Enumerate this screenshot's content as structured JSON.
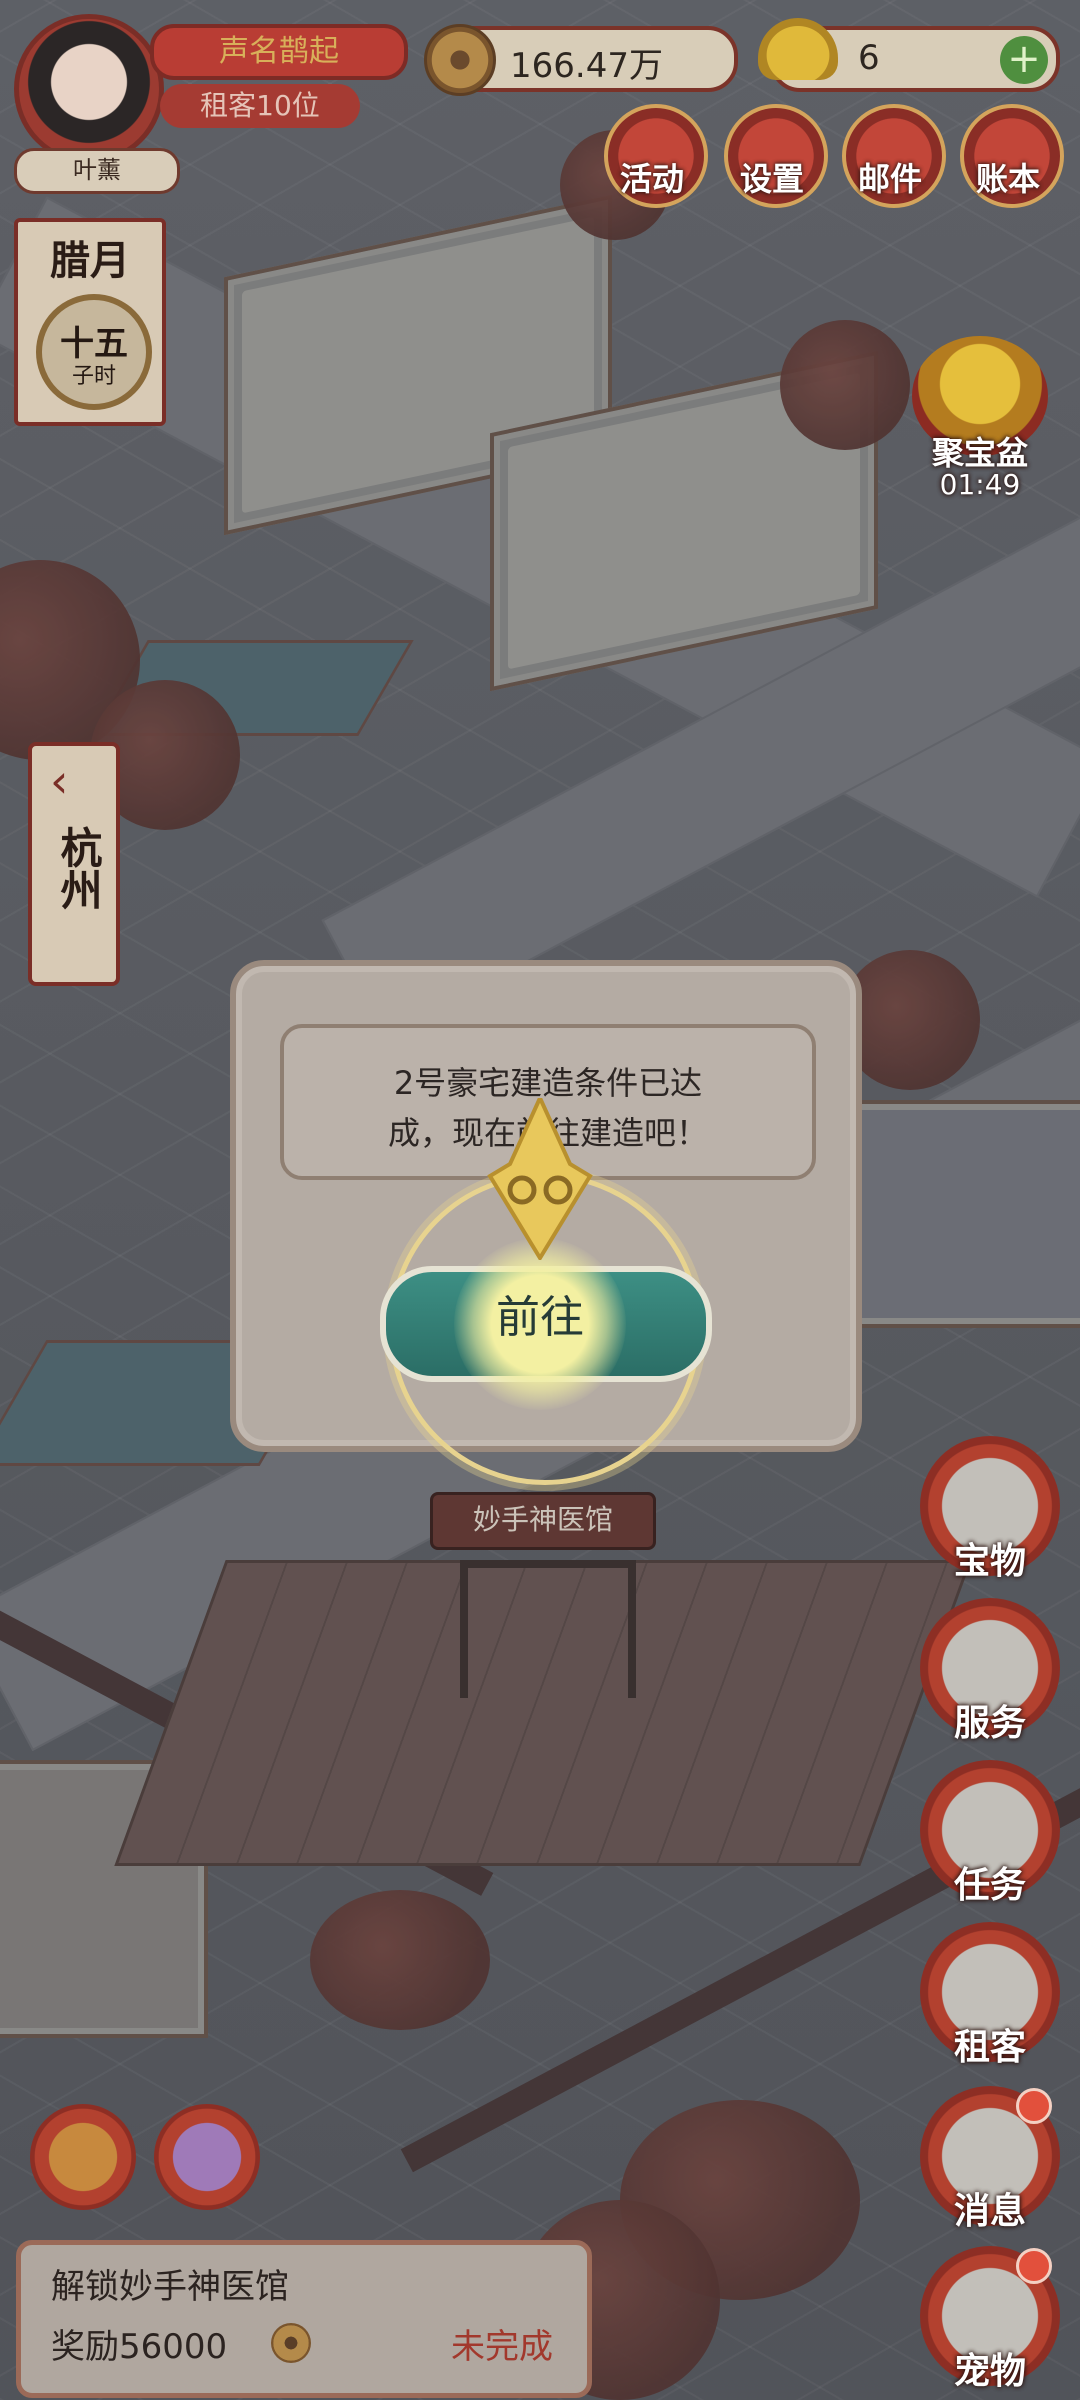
{
  "player": {
    "name": "叶薰",
    "fame_title": "声名鹊起",
    "tenant_rank": "租客10位"
  },
  "currency": {
    "copper": "166.47万",
    "gold_ingot": "6",
    "add_label": "+"
  },
  "top_menu": [
    {
      "label": "活动",
      "icon": "scroll-icon"
    },
    {
      "label": "设置",
      "icon": "flag-icon"
    },
    {
      "label": "邮件",
      "icon": "envelope-icon"
    },
    {
      "label": "账本",
      "icon": "ledger-icon"
    }
  ],
  "calendar": {
    "month": "腊月",
    "day": "十五",
    "time": "子时"
  },
  "treasure_pot": {
    "label": "聚宝盆",
    "timer": "01:49"
  },
  "city": {
    "arrow": "‹",
    "name": "杭州"
  },
  "dialog": {
    "line1": "2号豪宅建造条件已达",
    "line2": "成，现在前往建造吧！",
    "button": "前往"
  },
  "building_sign": "妙手神医馆",
  "side_menu": [
    {
      "label": "宝物",
      "icon": "ruyi-icon",
      "badge": false
    },
    {
      "label": "服务",
      "icon": "servant-icon",
      "badge": false
    },
    {
      "label": "任务",
      "icon": "task-card-icon",
      "badge": false
    },
    {
      "label": "租客",
      "icon": "tenant-portrait-icon",
      "badge": false
    },
    {
      "label": "消息",
      "icon": "notice-board-icon",
      "badge": true
    },
    {
      "label": "宠物",
      "icon": "cat-icon",
      "badge": true
    }
  ],
  "quest": {
    "title": "解锁妙手神医馆",
    "reward": "奖励56000",
    "status": "未完成"
  },
  "colors": {
    "accent_red": "#b93d34",
    "button_teal": "#3d8f84",
    "status_red": "#a2382c"
  }
}
